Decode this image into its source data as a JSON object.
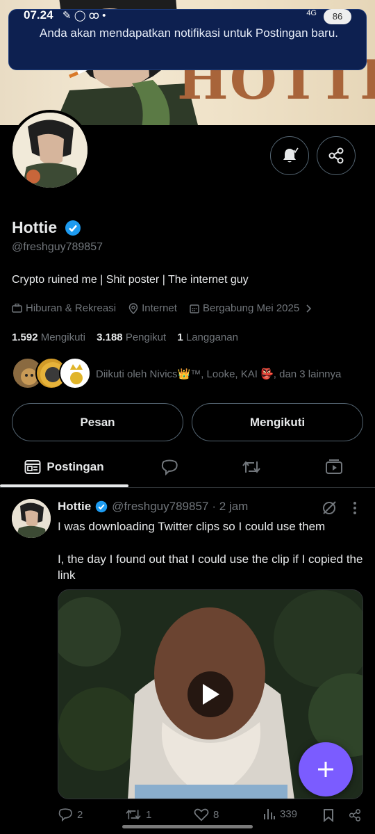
{
  "status_bar": {
    "time": "07.24",
    "network": "4G",
    "battery": "86"
  },
  "toast": {
    "message": "Anda akan mendapatkan notifikasi untuk Postingan baru."
  },
  "banner": {
    "text": "HOTTIE"
  },
  "profile": {
    "name": "Hottie",
    "handle": "@freshguy789857",
    "bio": "Crypto ruined me | Shit poster | The internet guy",
    "category": "Hiburan & Rekreasi",
    "location": "Internet",
    "joined": "Bergabung Mei 2025",
    "following_count": "1.592",
    "following_label": "Mengikuti",
    "followers_count": "3.188",
    "followers_label": "Pengikut",
    "subs_count": "1",
    "subs_label": "Langganan",
    "followed_by": "Diikuti oleh Nivics👑™, Looke, KAI 👺, dan 3 lainnya"
  },
  "buttons": {
    "message": "Pesan",
    "following": "Mengikuti"
  },
  "tabs": [
    {
      "label": "Postingan"
    }
  ],
  "tweet": {
    "name": "Hottie",
    "handle": "@freshguy789857",
    "time": "· 2 jam",
    "text_1": "I was downloading Twitter clips so I could use them",
    "text_2": "I, the day I found out that I could use the clip if I copied the link",
    "replies": "2",
    "reposts": "1",
    "likes": "8",
    "views": "339"
  },
  "colors": {
    "accent": "#1d9bf0",
    "fab": "#7b5cff",
    "toast_bg": "#0d2050"
  }
}
